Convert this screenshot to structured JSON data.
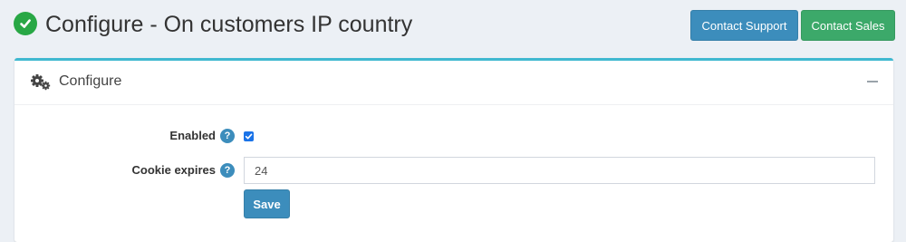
{
  "header": {
    "title": "Configure - On customers IP country",
    "status_icon": "check-circle-icon",
    "contact_support_label": "Contact Support",
    "contact_sales_label": "Contact Sales"
  },
  "card": {
    "title": "Configure",
    "header_icon": "cogs-icon",
    "collapse_icon": "minus-icon"
  },
  "form": {
    "enabled": {
      "label": "Enabled",
      "help_glyph": "?",
      "checked": true
    },
    "cookie_expires": {
      "label": "Cookie expires",
      "help_glyph": "?",
      "value": "24"
    },
    "save_label": "Save"
  },
  "colors": {
    "primary": "#3c8dbc",
    "success": "#28a745",
    "sales": "#3ca96a",
    "card_accent": "#3fb8d0",
    "page_background": "#ecf0f5"
  }
}
